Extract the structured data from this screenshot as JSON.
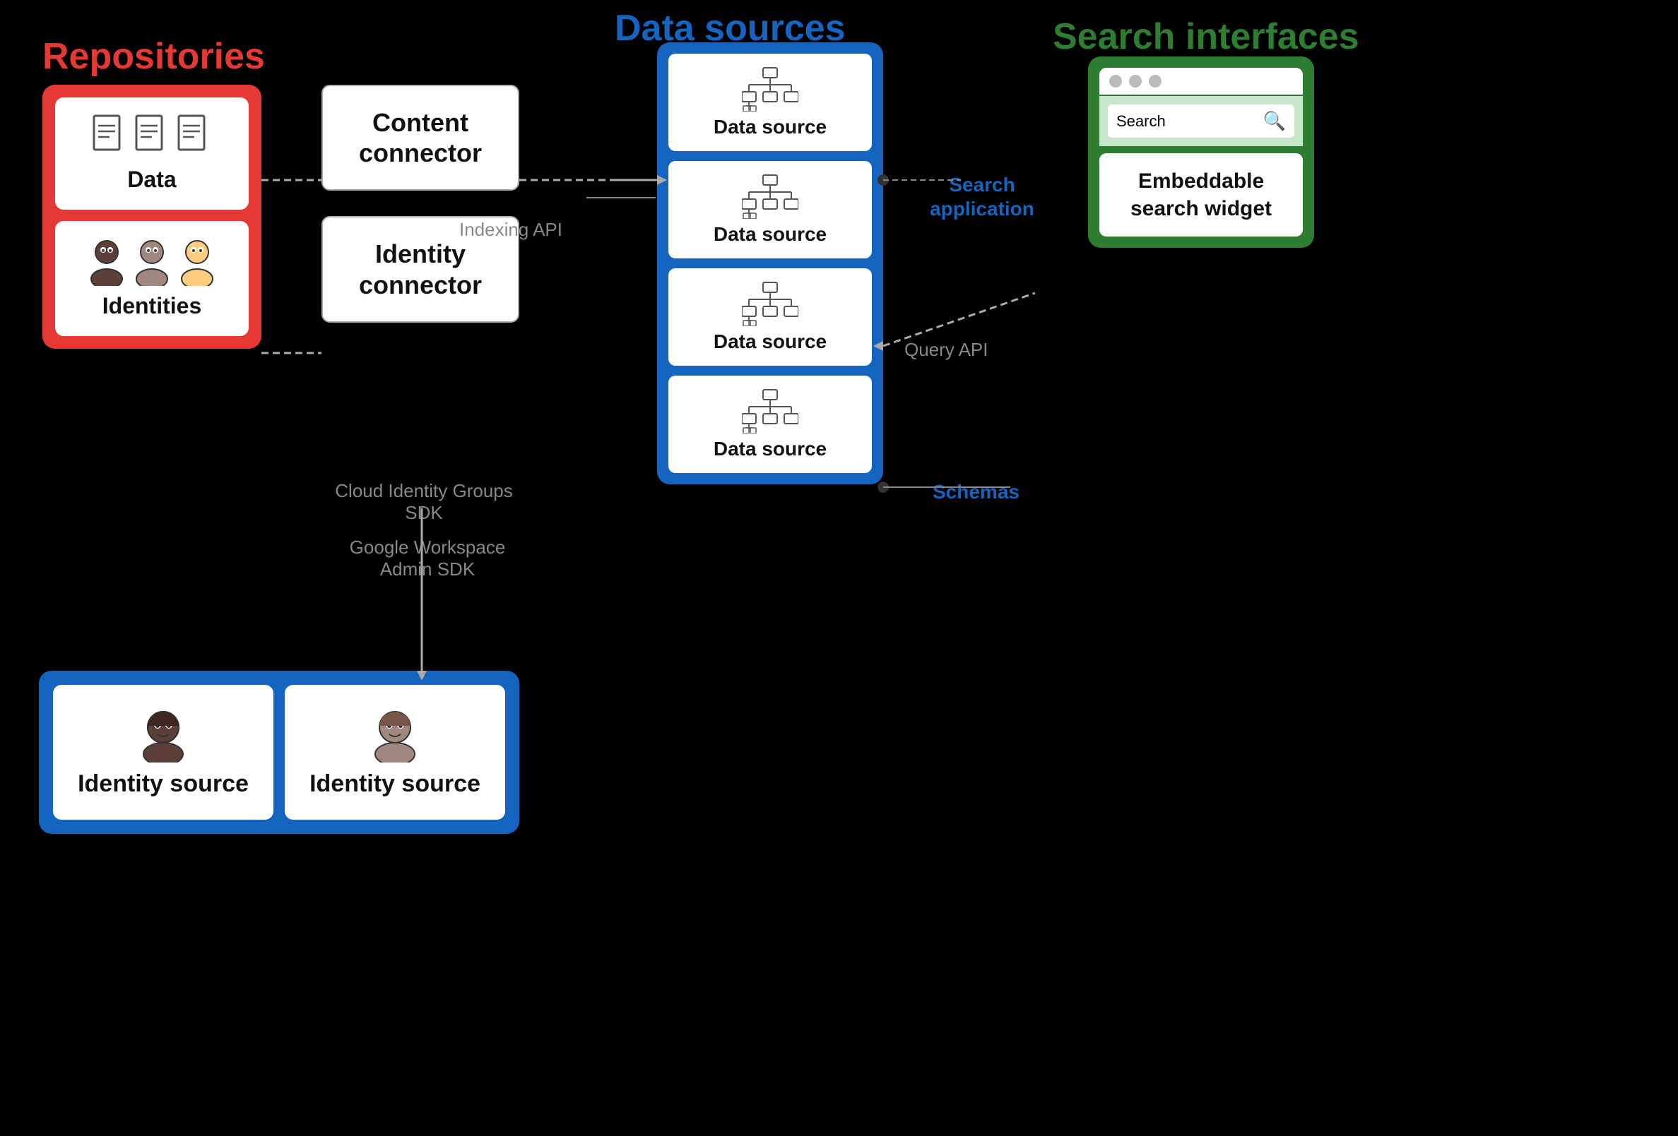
{
  "titles": {
    "repositories": "Repositories",
    "datasources": "Data sources",
    "search_interfaces": "Search interfaces"
  },
  "repositories": {
    "data_box_label": "Data",
    "identities_box_label": "Identities"
  },
  "connectors": {
    "content_connector_label": "Content connector",
    "identity_connector_label": "Identity connector"
  },
  "datasources": {
    "items": [
      {
        "label": "Data source"
      },
      {
        "label": "Data source"
      },
      {
        "label": "Data source"
      },
      {
        "label": "Data source"
      }
    ]
  },
  "identity_sources": {
    "items": [
      {
        "label": "Identity source"
      },
      {
        "label": "Identity source"
      }
    ]
  },
  "search_interfaces": {
    "search_label": "Search",
    "embeddable_label": "Embeddable search widget"
  },
  "arrow_labels": {
    "indexing_api": "Indexing API",
    "cloud_identity": "Cloud Identity Groups SDK",
    "google_workspace": "Google Workspace Admin SDK",
    "query_api": "Query API",
    "search_application": "Search application",
    "schemas": "Schemas"
  }
}
